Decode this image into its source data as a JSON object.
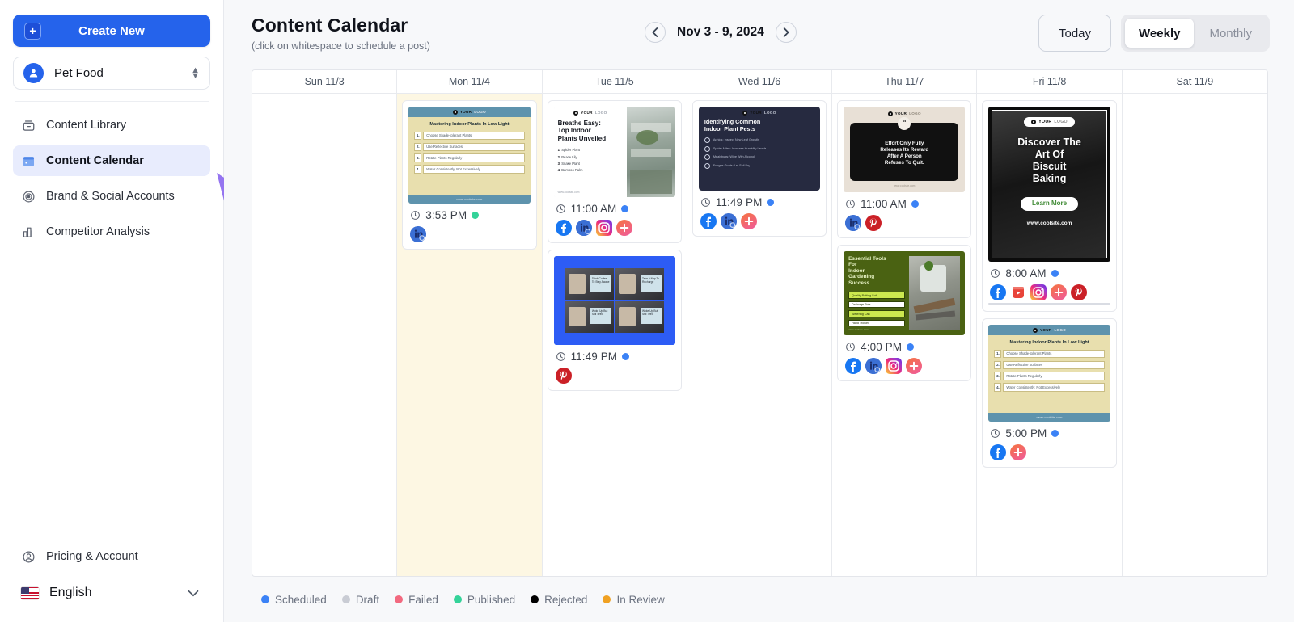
{
  "sidebar": {
    "create_button": "Create New",
    "brand": {
      "name": "Pet Food"
    },
    "items": [
      {
        "label": "Content Library",
        "icon": "library-icon",
        "active": false
      },
      {
        "label": "Content Calendar",
        "icon": "calendar-icon",
        "active": true
      },
      {
        "label": "Brand & Social Accounts",
        "icon": "at-circle-icon",
        "active": false
      },
      {
        "label": "Competitor Analysis",
        "icon": "bar-chart-icon",
        "active": false
      }
    ],
    "bottom": [
      {
        "label": "Pricing & Account",
        "icon": "user-circle-icon"
      }
    ],
    "language": {
      "label": "English",
      "flag": "us-flag-icon"
    }
  },
  "header": {
    "title": "Content Calendar",
    "subtitle": "(click on whitespace to schedule a post)",
    "week_label": "Nov 3 - 9, 2024",
    "prev_icon": "chevron-left-icon",
    "next_icon": "chevron-right-icon",
    "today_button": "Today",
    "view_options": [
      "Weekly",
      "Monthly"
    ],
    "view_selected": "Weekly"
  },
  "calendar": {
    "columns": [
      {
        "header": "Sun 11/3",
        "today": false,
        "posts": []
      },
      {
        "header": "Mon 11/4",
        "today": true,
        "posts": [
          {
            "time": "3:53 PM",
            "status": "published",
            "status_color": "#34d399",
            "template": "low-light-plants",
            "title": "Mastering Indoor Plants In Low Light",
            "items": [
              "Choose Shade-tolerant Plants",
              "Use Reflective Surfaces",
              "Rotate Plants Regularly",
              "Water Consistently, Not Excessively"
            ],
            "footer": "www.coolsite.com",
            "networks": [
              "linkedin"
            ]
          }
        ]
      },
      {
        "header": "Tue 11/5",
        "today": false,
        "posts": [
          {
            "time": "11:00 AM",
            "status": "scheduled",
            "status_color": "#3b82f6",
            "template": "breathe-easy",
            "title": "Breathe Easy: Top Indoor Plants Unveiled",
            "items": [
              "Spider Plant",
              "Peace Lily",
              "Snake Plant",
              "Bamboo Palm"
            ],
            "footer": "www.coolsite.com",
            "networks": [
              "facebook",
              "linkedin",
              "instagram",
              "more"
            ]
          },
          {
            "time": "11:49 PM",
            "status": "scheduled",
            "status_color": "#3b82f6",
            "template": "meme-grid",
            "title": "",
            "items": [
              "Drink Coffee To Stay Awake",
              "Take A Nap To Recharge",
              "Woke Up But Still Tired",
              "Woke Up But Still Tired"
            ],
            "footer": "",
            "networks": [
              "pinterest"
            ]
          }
        ]
      },
      {
        "header": "Wed 11/6",
        "today": false,
        "posts": [
          {
            "time": "11:49 PM",
            "status": "scheduled",
            "status_color": "#3b82f6",
            "template": "plant-pests",
            "title": "Identifying Common Indoor Plant Pests",
            "items": [
              "Aphids: Inspect New Leaf Growth",
              "Spider Mites: Increase Humidity Levels",
              "Mealybugs: Wipe With Alcohol",
              "Fungus Gnats: Let Soil Dry"
            ],
            "footer": "",
            "networks": [
              "facebook",
              "linkedin",
              "more"
            ]
          }
        ]
      },
      {
        "header": "Thu 11/7",
        "today": false,
        "posts": [
          {
            "time": "11:00 AM",
            "status": "scheduled",
            "status_color": "#3b82f6",
            "template": "quote-card",
            "title": "Effort Only Fully Releases Its Reward After A Person Refuses To Quit.",
            "items": [],
            "footer": "www.coolsite.com",
            "networks": [
              "linkedin",
              "pinterest"
            ]
          },
          {
            "time": "4:00 PM",
            "status": "scheduled",
            "status_color": "#3b82f6",
            "template": "garden-tools",
            "title": "Essential Tools For Indoor Gardening Success",
            "items": [
              "Quality Potting Soil",
              "Drainage Pots",
              "Watering Can",
              "Hand Trowel"
            ],
            "footer": "www.coolsite.com",
            "networks": [
              "facebook",
              "linkedin",
              "instagram",
              "more"
            ]
          }
        ]
      },
      {
        "header": "Fri 11/8",
        "today": false,
        "posts": [
          {
            "time": "8:00 AM",
            "status": "scheduled",
            "status_color": "#3b82f6",
            "template": "biscuit-baking",
            "title": "Discover The Art Of Biscuit Baking",
            "items": [
              "Learn More"
            ],
            "footer": "www.coolsite.com",
            "networks": [
              "facebook",
              "youtube",
              "instagram",
              "more",
              "pinterest"
            ]
          },
          {
            "time": "5:00 PM",
            "status": "scheduled",
            "status_color": "#3b82f6",
            "template": "low-light-plants",
            "title": "Mastering Indoor Plants In Low Light",
            "items": [
              "Choose Shade-tolerant Plants",
              "Use Reflective Surfaces",
              "Rotate Plants Regularly",
              "Water Consistently, Not Excessively"
            ],
            "footer": "www.coolsite.com",
            "networks": [
              "facebook",
              "more"
            ]
          }
        ]
      },
      {
        "header": "Sat 11/9",
        "today": false,
        "posts": []
      }
    ]
  },
  "legend": [
    {
      "label": "Scheduled",
      "color": "#3b82f6"
    },
    {
      "label": "Draft",
      "color": "#c9ccd4"
    },
    {
      "label": "Failed",
      "color": "#f2697f"
    },
    {
      "label": "Published",
      "color": "#34d399"
    },
    {
      "label": "Rejected",
      "color": "#000000"
    },
    {
      "label": "In Review",
      "color": "#f0a122"
    }
  ],
  "annotation": {
    "type": "curved-arrow",
    "color": "#9575f0",
    "points_to": "Content Calendar"
  },
  "theme": {
    "accent": "#2563eb",
    "active_bg": "#e8ecfd",
    "canvas": "#f7f8fa",
    "today_bg": "#fdf7e3"
  }
}
